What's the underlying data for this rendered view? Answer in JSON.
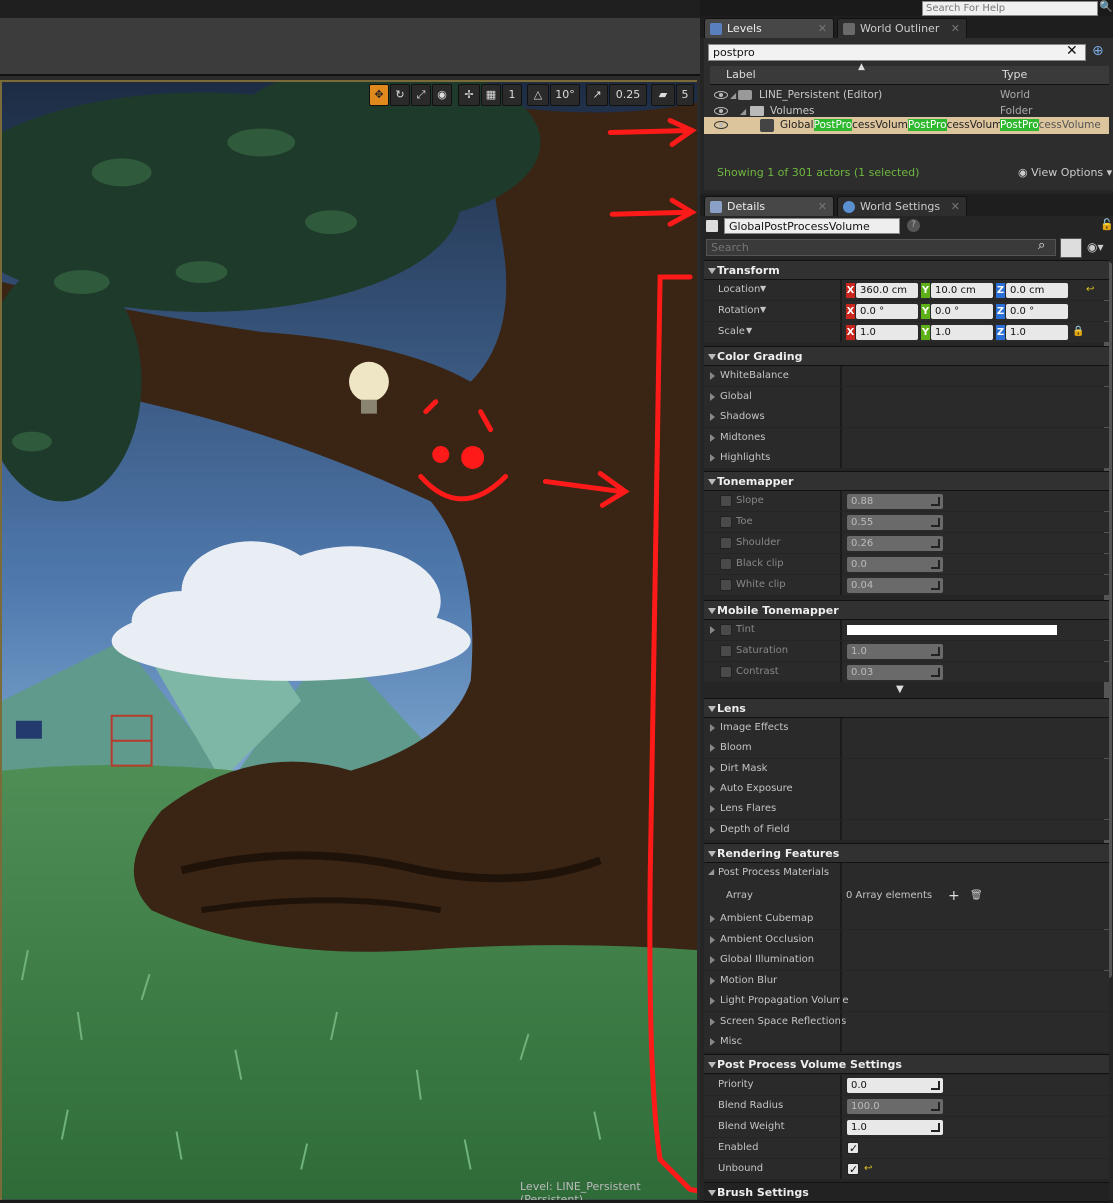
{
  "topbar": {
    "help_placeholder": "Search For Help"
  },
  "viewport": {
    "toolbar": {
      "grid_snap": "1",
      "rot_snap": "10°",
      "scale_snap": "0.25",
      "cam_speed": "5"
    },
    "level_label": "Level:  LINE_Persistent (Persistent)"
  },
  "tabs_top": {
    "levels": "Levels",
    "outliner": "World Outliner"
  },
  "outliner": {
    "search_value": "postpro",
    "col_label": "Label",
    "col_type": "Type",
    "rows": [
      {
        "label": "LINE_Persistent (Editor)",
        "type": "World"
      },
      {
        "label": "Volumes",
        "type": "Folder"
      },
      {
        "label_parts": [
          "Global",
          "PostPro",
          "cessVolum",
          "PostPro",
          "cessVolume "
        ],
        "type_parts": [
          "PostPro",
          "cessVolume"
        ]
      }
    ],
    "status": "Showing 1 of 301 actors (1 selected)",
    "view_options": "View Options"
  },
  "tabs_mid": {
    "details": "Details",
    "world_settings": "World Settings"
  },
  "details": {
    "name_value": "GlobalPostProcessVolume",
    "search_placeholder": "Search",
    "transform": {
      "title": "Transform",
      "location_label": "Location",
      "rotation_label": "Rotation",
      "scale_label": "Scale",
      "location": [
        "360.0 cm",
        "10.0 cm",
        "0.0 cm"
      ],
      "rotation": [
        "0.0 °",
        "0.0 °",
        "0.0 °"
      ],
      "scale": [
        "1.0",
        "1.0",
        "1.0"
      ],
      "axes": [
        "X",
        "Y",
        "Z"
      ]
    },
    "color_grading": {
      "title": "Color Grading",
      "items": [
        "WhiteBalance",
        "Global",
        "Shadows",
        "Midtones",
        "Highlights"
      ]
    },
    "tonemapper": {
      "title": "Tonemapper",
      "items": [
        {
          "label": "Slope",
          "value": "0.88"
        },
        {
          "label": "Toe",
          "value": "0.55"
        },
        {
          "label": "Shoulder",
          "value": "0.26"
        },
        {
          "label": "Black clip",
          "value": "0.0"
        },
        {
          "label": "White clip",
          "value": "0.04"
        }
      ]
    },
    "mobile_tonemapper": {
      "title": "Mobile Tonemapper",
      "tint_label": "Tint",
      "items": [
        {
          "label": "Saturation",
          "value": "1.0"
        },
        {
          "label": "Contrast",
          "value": "0.03"
        }
      ]
    },
    "lens": {
      "title": "Lens",
      "items": [
        "Image Effects",
        "Bloom",
        "Dirt Mask",
        "Auto Exposure",
        "Lens Flares",
        "Depth of Field"
      ]
    },
    "rendering": {
      "title": "Rendering Features",
      "ppm_label": "Post Process Materials",
      "array_label": "Array",
      "array_value": "0 Array elements",
      "items": [
        "Ambient Cubemap",
        "Ambient Occlusion",
        "Global Illumination",
        "Motion Blur",
        "Light Propagation Volume",
        "Screen Space Reflections",
        "Misc"
      ]
    },
    "ppv_settings": {
      "title": "Post Process Volume Settings",
      "items": [
        {
          "label": "Priority",
          "value": "0.0"
        },
        {
          "label": "Blend Radius",
          "value": "100.0"
        },
        {
          "label": "Blend Weight",
          "value": "1.0"
        }
      ],
      "enabled_label": "Enabled",
      "unbound_label": "Unbound"
    },
    "brush": {
      "title": "Brush Settings"
    }
  },
  "colors": {
    "accent": "#e08a1e",
    "highlight": "#2db82d",
    "annotation": "#ff1a1a",
    "axis_x": "#c9261d",
    "axis_y": "#5eb018",
    "axis_z": "#2a6fd6"
  }
}
